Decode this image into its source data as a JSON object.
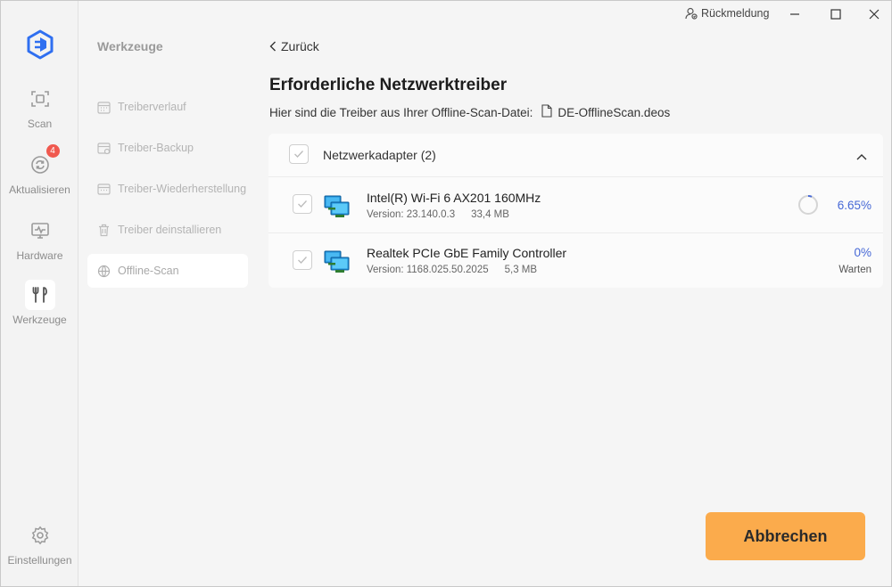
{
  "titlebar": {
    "feedback_label": "Rückmeldung"
  },
  "rail": {
    "items": [
      {
        "label": "Scan",
        "icon": "scan-icon"
      },
      {
        "label": "Aktualisieren",
        "icon": "refresh-icon",
        "badge": "4"
      },
      {
        "label": "Hardware",
        "icon": "hardware-icon"
      },
      {
        "label": "Werkzeuge",
        "icon": "tools-icon",
        "active": true
      }
    ],
    "settings_label": "Einstellungen"
  },
  "tools": {
    "title": "Werkzeuge",
    "items": [
      {
        "label": "Treiberverlauf",
        "icon": "calendar-icon"
      },
      {
        "label": "Treiber-Backup",
        "icon": "backup-icon"
      },
      {
        "label": "Treiber-Wiederherstellung",
        "icon": "restore-icon"
      },
      {
        "label": "Treiber deinstallieren",
        "icon": "trash-icon"
      },
      {
        "label": "Offline-Scan",
        "icon": "globe-icon",
        "active": true
      }
    ]
  },
  "main": {
    "back_label": "Zurück",
    "title": "Erforderliche Netzwerktreiber",
    "subtitle": "Hier sind die Treiber aus Ihrer Offline-Scan-Datei:",
    "file_name": "DE-OfflineScan.deos",
    "group": {
      "label": "Netzwerkadapter (2)",
      "drivers": [
        {
          "name": "Intel(R) Wi-Fi 6 AX201 160MHz",
          "version": "Version: 23.140.0.3",
          "size": "33,4 MB",
          "progress": "6.65%",
          "status": ""
        },
        {
          "name": "Realtek PCIe GbE Family Controller",
          "version": "Version: 1168.025.50.2025",
          "size": "5,3 MB",
          "progress": "0%",
          "status": "Warten"
        }
      ]
    },
    "cancel_label": "Abbrechen"
  },
  "colors": {
    "accent_blue": "#4668d6",
    "cancel_button": "#fbab4c",
    "badge_red": "#f0594f",
    "logo_blue": "#2f6ff0"
  }
}
